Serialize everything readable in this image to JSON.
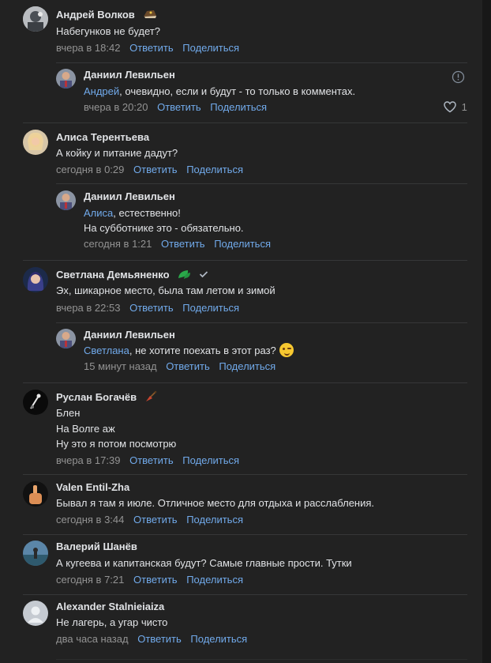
{
  "comments": [
    {
      "author": "Андрей Волков",
      "lines": [
        "Набегунков не будет?"
      ],
      "time": "вчера в 18:42",
      "reply": "Ответить",
      "share": "Поделиться"
    },
    {
      "author": "Даниил Левильен",
      "mention": "Андрей",
      "rest": ", очевидно, если и будут - то только в комментах.",
      "time": "вчера в 20:20",
      "reply": "Ответить",
      "share": "Поделиться",
      "likes": "1"
    },
    {
      "author": "Алиса Терентьева",
      "lines": [
        "А койку и питание дадут?"
      ],
      "time": "сегодня в 0:29",
      "reply": "Ответить",
      "share": "Поделиться"
    },
    {
      "author": "Даниил Левильен",
      "mention": "Алиса",
      "rest": ", естественно!",
      "line2": "На субботнике это - обязательно.",
      "time": "сегодня в 1:21",
      "reply": "Ответить",
      "share": "Поделиться"
    },
    {
      "author": "Светлана Демьяненко",
      "lines": [
        "Эх, шикарное место, была там летом и зимой"
      ],
      "time": "вчера в 22:53",
      "reply": "Ответить",
      "share": "Поделиться"
    },
    {
      "author": "Даниил Левильен",
      "mention": "Светлана",
      "rest": ", не хотите поехать в этот раз?",
      "time": "15 минут назад",
      "reply": "Ответить",
      "share": "Поделиться"
    },
    {
      "author": "Руслан Богачёв",
      "lines": [
        "Блен",
        "На Волге аж",
        "Ну это я потом посмотрю"
      ],
      "time": "вчера в 17:39",
      "reply": "Ответить",
      "share": "Поделиться"
    },
    {
      "author": "Valen Entil-Zha",
      "lines": [
        "Бывал я там я июле. Отличное место для отдыха и расслабления."
      ],
      "time": "сегодня в 3:44",
      "reply": "Ответить",
      "share": "Поделиться"
    },
    {
      "author": "Валерий Шанёв",
      "lines": [
        "А кугеева и капитанская будут? Самые главные прости. Тутки"
      ],
      "time": "сегодня в 7:21",
      "reply": "Ответить",
      "share": "Поделиться"
    },
    {
      "author": "Alexander Stalnieiaiza",
      "lines": [
        "Не лагерь, а угар чисто"
      ],
      "time": "два часа назад",
      "reply": "Ответить",
      "share": "Поделиться"
    }
  ],
  "icons": {
    "ushanka": "ushanka-hat-icon",
    "info": "info-circle-icon",
    "heart": "heart-icon",
    "leaf": "green-leaf-icon",
    "check": "verified-check-icon",
    "balalaika": "balalaika-icon",
    "wink": "winking-face-emoji"
  },
  "colors": {
    "link": "#71aaeb",
    "muted": "#939393",
    "text": "#e1e3e6",
    "bg": "#222222"
  }
}
